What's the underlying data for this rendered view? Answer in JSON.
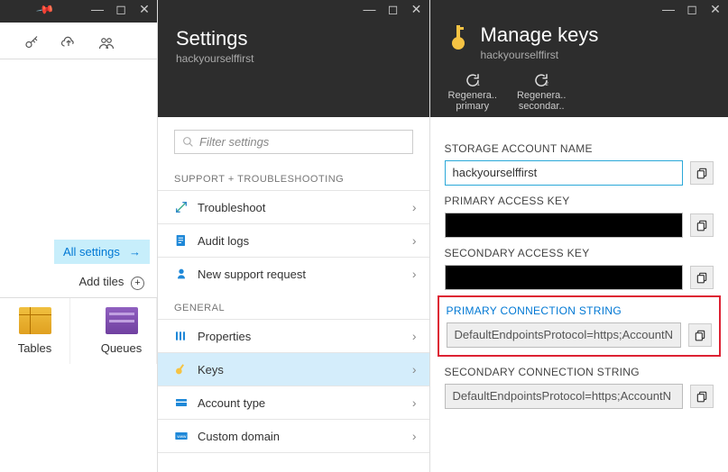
{
  "col1": {
    "all_settings": "All settings",
    "add_tiles": "Add tiles",
    "tiles": [
      {
        "label": "Tables"
      },
      {
        "label": "Queues"
      }
    ]
  },
  "settings": {
    "title": "Settings",
    "subtitle": "hackyourselffirst",
    "filter_placeholder": "Filter settings",
    "sections": {
      "support": {
        "header": "SUPPORT + TROUBLESHOOTING",
        "items": [
          {
            "label": "Troubleshoot"
          },
          {
            "label": "Audit logs"
          },
          {
            "label": "New support request"
          }
        ]
      },
      "general": {
        "header": "GENERAL",
        "items": [
          {
            "label": "Properties"
          },
          {
            "label": "Keys"
          },
          {
            "label": "Account type"
          },
          {
            "label": "Custom domain"
          }
        ]
      }
    }
  },
  "managekeys": {
    "title": "Manage keys",
    "subtitle": "hackyourselffirst",
    "tools": [
      {
        "label1": "Regenera..",
        "label2": "primary"
      },
      {
        "label1": "Regenera..",
        "label2": "secondar.."
      }
    ],
    "fields": {
      "name_label": "STORAGE ACCOUNT NAME",
      "name_value": "hackyourselffirst",
      "pak_label": "PRIMARY ACCESS KEY",
      "sak_label": "SECONDARY ACCESS KEY",
      "pcs_label": "PRIMARY CONNECTION STRING",
      "pcs_value": "DefaultEndpointsProtocol=https;AccountN",
      "scs_label": "SECONDARY CONNECTION STRING",
      "scs_value": "DefaultEndpointsProtocol=https;AccountN"
    }
  }
}
